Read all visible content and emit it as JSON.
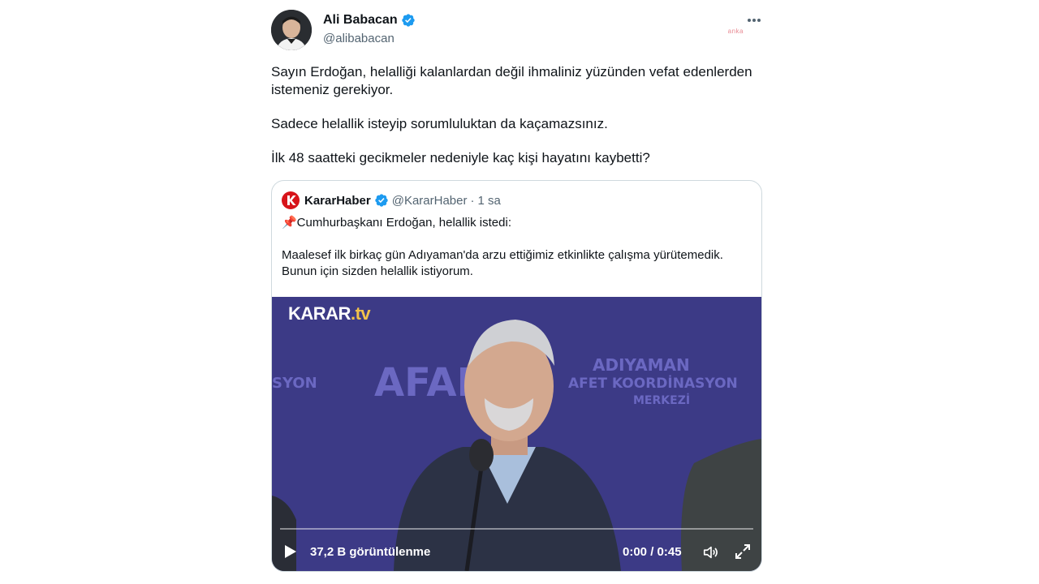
{
  "author": {
    "name": "Ali Babacan",
    "handle": "@alibabacan",
    "verified": true
  },
  "watermark": "anka",
  "tweet_paragraphs": [
    "Sayın Erdoğan, helalliği kalanlardan değil ihmaliniz yüzünden vefat edenlerden istemeniz gerekiyor.",
    "Sadece helallik isteyip sorumluluktan da kaçamazsınız.",
    "İlk 48 saatteki gecikmeler nedeniyle kaç kişi hayatını kaybetti?"
  ],
  "quote": {
    "name": "KararHaber",
    "handle": "@KararHaber",
    "separator": "·",
    "time": "1 sa",
    "paragraphs": [
      "📌Cumhurbaşkanı Erdoğan, helallik istedi:",
      "Maalesef ilk birkaç gün Adıyaman'da arzu ettiğimiz etkinlikte çalışma yürütemedik. Bunun için sizden helallik istiyorum."
    ],
    "video": {
      "brand_main": "KARAR",
      "brand_suffix": ".tv",
      "bg_afad": "AFAD",
      "bg_city": "ADIYAMAN",
      "bg_line2": "AFET KOORDİNASYON",
      "bg_line3": "MERKEZİ",
      "bg_left": "SYON",
      "views": "37,2 B görüntülenme",
      "time": "0:00 / 0:45",
      "progress": 0
    }
  },
  "colors": {
    "verified": "#1d9bf0",
    "karar_red": "#d7141a",
    "video_bg": "#3c3a86"
  }
}
